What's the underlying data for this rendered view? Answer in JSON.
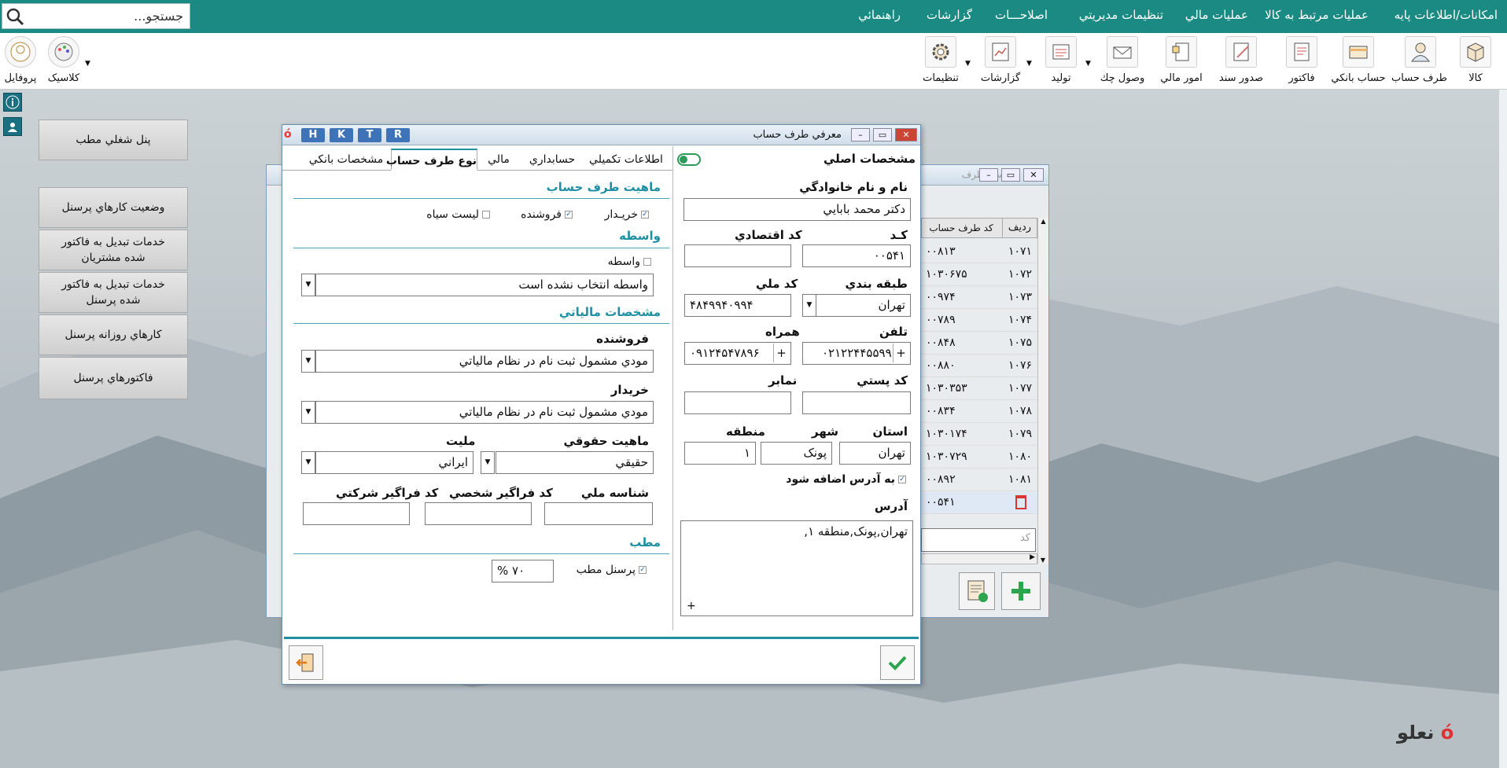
{
  "menu": {
    "search_placeholder": "جستجو...",
    "items": [
      "امکانات/اطلاعات پايه",
      "عمليات مرتبط به کالا",
      "عمليات مالي",
      "تنظيمات مديريتي",
      "اصلاحـــات",
      "گزارشات",
      "راهنمائي"
    ]
  },
  "toolbar": {
    "items": [
      {
        "label": "کالا",
        "icon": "box-icon"
      },
      {
        "label": "طرف حساب",
        "icon": "person-icon"
      },
      {
        "label": "حساب بانکي",
        "icon": "bank-card-icon"
      },
      {
        "label": "فاکتور",
        "icon": "invoice-icon"
      },
      {
        "label": "صدور سند",
        "icon": "document-pen-icon"
      },
      {
        "label": "امور مالي",
        "icon": "finance-icon"
      },
      {
        "label": "وصول چك",
        "icon": "envelope-check-icon"
      },
      {
        "label": "توليد",
        "icon": "production-icon"
      },
      {
        "label": "گزارشات",
        "icon": "report-chart-icon"
      },
      {
        "label": "تنظيمات",
        "icon": "gear-icon"
      }
    ],
    "left_items": [
      {
        "label": "پروفايل",
        "icon": "profile-icon"
      },
      {
        "label": "کلاسيک",
        "icon": "palette-icon"
      }
    ]
  },
  "side_panel": {
    "buttons": [
      "پنل شغلي مطب",
      "وضعيت کارهاي پرسنل",
      "خدمات تبديل به فاکتور شده مشتريان",
      "خدمات تبديل به فاکتور شده پرسنل",
      "کارهاي روزانه پرسنل",
      "فاکتورهاي پرسنل"
    ]
  },
  "list_window": {
    "title": "ليست طرف",
    "headers": [
      "رديف",
      "کد طرف حساب"
    ],
    "rows": [
      [
        "۱۰۷۱",
        "۰۰۸۱۳"
      ],
      [
        "۱۰۷۲",
        "۱۰۳۰۶۷۵"
      ],
      [
        "۱۰۷۳",
        "۰۰۹۷۴"
      ],
      [
        "۱۰۷۴",
        "۰۰۷۸۹"
      ],
      [
        "۱۰۷۵",
        "۰۰۸۴۸"
      ],
      [
        "۱۰۷۶",
        "۰۰۸۸۰"
      ],
      [
        "۱۰۷۷",
        "۱۰۳۰۳۵۳"
      ],
      [
        "۱۰۷۸",
        "۰۰۸۳۴"
      ],
      [
        "۱۰۷۹",
        "۱۰۳۰۱۷۴"
      ],
      [
        "۱۰۸۰",
        "۱۰۳۰۷۲۹"
      ],
      [
        "۱۰۸۱",
        "۰۰۸۹۲"
      ],
      [
        "",
        "۰۰۵۴۱"
      ]
    ],
    "filter_placeholder": "کد"
  },
  "dialog": {
    "title": "معرفي طرف حساب",
    "hotkeys": [
      "H",
      "K",
      "T",
      "R"
    ],
    "right": {
      "header": "مشخصات اصلي",
      "name_label": "نام و نام خانوادگي",
      "name_value": "دکتر محمد بابايي",
      "code_label": "کـد",
      "code_value": "۰۰۵۴۱",
      "eco_label": "کد اقتصادي",
      "eco_value": "",
      "class_label": "طبقه بندي",
      "class_value": "تهران",
      "national_label": "کد ملي",
      "national_value": "۴۸۴۹۹۴۰۹۹۴",
      "phone_label": "تلفن",
      "phone_value": "۰۲۱۲۲۴۴۵۵۹۹",
      "mobile_label": "همراه",
      "mobile_value": "۰۹۱۲۴۵۴۷۸۹۶",
      "postal_label": "کد پستي",
      "fax_label": "نمابر",
      "province_label": "استان",
      "province_value": "تهران",
      "city_label": "شهر",
      "city_value": "پونک",
      "region_label": "منطقه",
      "region_value": "۱",
      "add_to_address": "به آدرس اضافه شود",
      "address_label": "آدرس",
      "address_value": "تهران,پونک,منطقه ۱,"
    },
    "tabs": [
      "اطلاعات تکميلي",
      "حسابداري",
      "مالي",
      "نوع طرف حساب",
      "مشخصات بانکي"
    ],
    "active_tab": 3,
    "left": {
      "sec_nature": "ماهيت طرف حساب",
      "buyer": "خريـدار",
      "seller": "فروشنده",
      "blacklist": "ليست سياه",
      "sec_broker": "واسطه",
      "broker_cb": "واسطه",
      "broker_value": "واسطه انتخاب نشده است",
      "sec_tax": "مشخصات مالياتي",
      "seller_label": "فروشنده",
      "seller_value": "مودي مشمول ثبت نام در نظام مالياتي",
      "buyer_label": "خريدار",
      "buyer_value": "مودي مشمول ثبت نام در نظام مالياتي",
      "legal_label": "ماهيت حقوقي",
      "legal_value": "حقيقي",
      "nation_label": "مليت",
      "nation_value": "ايراني",
      "nid_label": "شناسه ملي",
      "pid_label": "کد فراگير شخصي",
      "cid_label": "کد فراگير شرکتي",
      "sec_clinic": "مطب",
      "staff_cb": "پرسنل مطب",
      "percent_value": "۷۰",
      "percent_sign": "%"
    }
  },
  "brand": "نعلو"
}
